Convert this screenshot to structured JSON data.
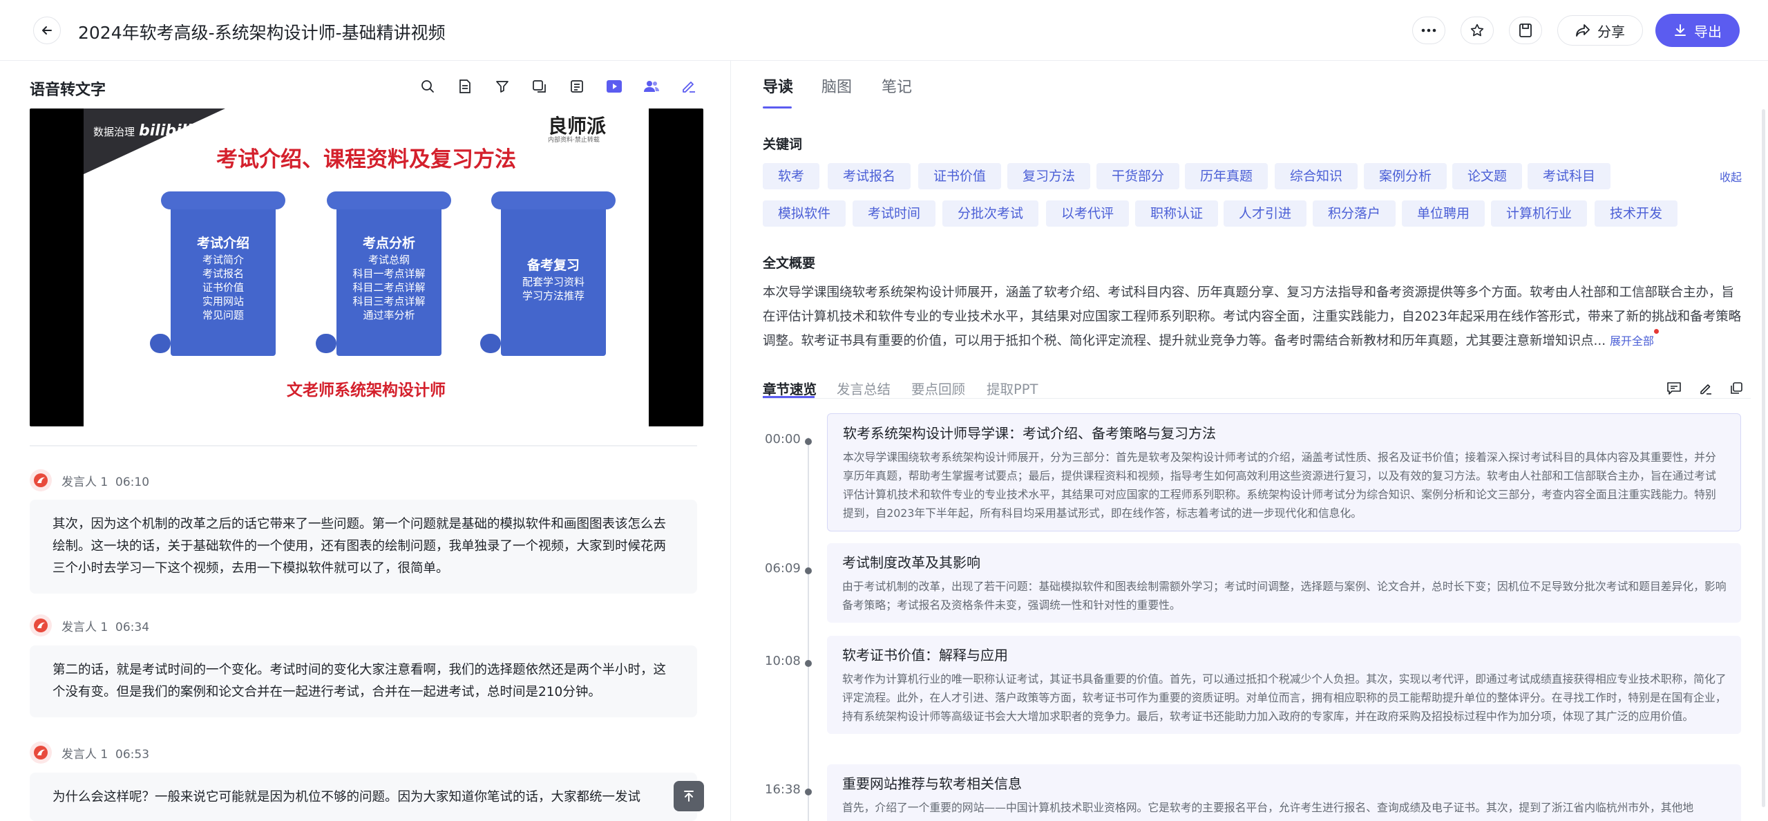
{
  "header": {
    "title": "2024年软考高级-系统架构设计师-基础精讲视频",
    "share_label": "分享",
    "export_label": "导出"
  },
  "left": {
    "panel_title": "语音转文字",
    "slide": {
      "brand": "数据治理",
      "brand_logo": "bilibili",
      "logo": "良师派",
      "logo_sub": "内部资料·禁止转载",
      "heading": "考试介绍、课程资料及复习方法",
      "footer": "文老师系统架构设计师",
      "scrolls": [
        {
          "title": "考试介绍",
          "items": [
            "考试简介",
            "考试报名",
            "证书价值",
            "实用网站",
            "常见问题"
          ]
        },
        {
          "title": "考点分析",
          "items": [
            "考试总纲",
            "科目一考点详解",
            "科目二考点详解",
            "科目三考点详解",
            "通过率分析"
          ]
        },
        {
          "title": "备考复习",
          "items": [
            "配套学习资料",
            "学习方法推荐"
          ]
        }
      ]
    },
    "transcript": [
      {
        "speaker": "发言人 1",
        "time": "06:10",
        "text": "其次，因为这个机制的改革之后的话它带来了一些问题。第一个问题就是基础的模拟软件和画图图表该怎么去绘制。这一块的话，关于基础软件的一个使用，还有图表的绘制问题，我单独录了一个视频，大家到时候花两三个小时去学习一下这个视频，去用一下模拟软件就可以了，很简单。"
      },
      {
        "speaker": "发言人 1",
        "time": "06:34",
        "text": "第二的话，就是考试时间的一个变化。考试时间的变化大家注意看啊，我们的选择题依然还是两个半小时，这个没有变。但是我们的案例和论文合并在一起进行考试，合并在一起进考试，总时间是210分钟。"
      },
      {
        "speaker": "发言人 1",
        "time": "06:53",
        "text": "为什么会这样呢？一般来说它可能就是因为机位不够的问题。因为大家知道你笔试的话，大家都统一发试"
      }
    ]
  },
  "right": {
    "tabs": [
      "导读",
      "脑图",
      "笔记"
    ],
    "keywords_title": "关键词",
    "keywords_row1": [
      "软考",
      "考试报名",
      "证书价值",
      "复习方法",
      "干货部分",
      "历年真题",
      "综合知识",
      "案例分析",
      "论文题",
      "考试科目"
    ],
    "keywords_row2": [
      "模拟软件",
      "考试时间",
      "分批次考试",
      "以考代评",
      "职称认证",
      "人才引进",
      "积分落户",
      "单位聘用",
      "计算机行业",
      "技术开发"
    ],
    "collapse_label": "收起",
    "summary_title": "全文概要",
    "summary": "本次导学课围绕软考系统架构设计师展开，涵盖了软考介绍、考试科目内容、历年真题分享、复习方法指导和备考资源提供等多个方面。软考由人社部和工信部联合主办，旨在评估计算机技术和软件专业的专业技术水平，其结果对应国家工程师系列职称。考试内容全面，注重实践能力，自2023年起采用在线作答形式，带来了新的挑战和备考策略调整。软考证书具有重要的价值，可以用于抵扣个税、简化评定流程、提升就业竞争力等。备考时需结合新教材和历年真题，尤其要注意新增知识点...",
    "expand_label": "展开全部",
    "subtabs": [
      "章节速览",
      "发言总结",
      "要点回顾",
      "提取PPT"
    ],
    "chapters": [
      {
        "time": "00:00",
        "title": "软考系统架构设计师导学课：考试介绍、备考策略与复习方法",
        "body": "本次导学课围绕软考系统架构设计师展开，分为三部分：首先是软考及架构设计师考试的介绍，涵盖考试性质、报名及证书价值；接着深入探讨考试科目的具体内容及其重要性，并分享历年真题，帮助考生掌握考试要点；最后，提供课程资料和视频，指导考生如何高效利用这些资源进行复习，以及有效的复习方法。软考由人社部和工信部联合主办，旨在通过考试评估计算机技术和软件专业的专业技术水平，其结果可对应国家的工程师系列职称。系统架构设计师考试分为综合知识、案例分析和论文三部分，考查内容全面且注重实践能力。特别提到，自2023年下半年起，所有科目均采用基试形式，即在线作答，标志着考试的进一步现代化和信息化。"
      },
      {
        "time": "06:09",
        "title": "考试制度改革及其影响",
        "body": "由于考试机制的改革，出现了若干问题：基础模拟软件和图表绘制需额外学习；考试时间调整，选择题与案例、论文合并，总时长下变；因机位不足导致分批次考试和题目差异化，影响备考策略；考试报名及资格条件未变，强调统一性和针对性的重要性。"
      },
      {
        "time": "10:08",
        "title": "软考证书价值：解释与应用",
        "body": "软考作为计算机行业的唯一职称认证考试，其证书具备重要的价值。首先，可以通过抵扣个税减少个人负担。其次，实现以考代评，即通过考试成绩直接获得相应专业技术职称，简化了评定流程。此外，在人才引进、落户政策等方面，软考证书可作为重要的资质证明。对单位而言，拥有相应职称的员工能帮助提升单位的整体评分。在寻找工作时，特别是在国有企业，持有系统架构设计师等高级证书会大大增加求职者的竞争力。最后，软考证书还能助力加入政府的专家库，并在政府采购及招投标过程中作为加分项，体现了其广泛的应用价值。"
      },
      {
        "time": "16:38",
        "title": "重要网站推荐与软考相关信息",
        "body": "首先，介绍了一个重要的网站——中国计算机技术职业资格网。它是软考的主要报名平台，允许考生进行报名、查询成绩及电子证书。其次，提到了浙江省内临杭州市外，其他地"
      }
    ]
  }
}
